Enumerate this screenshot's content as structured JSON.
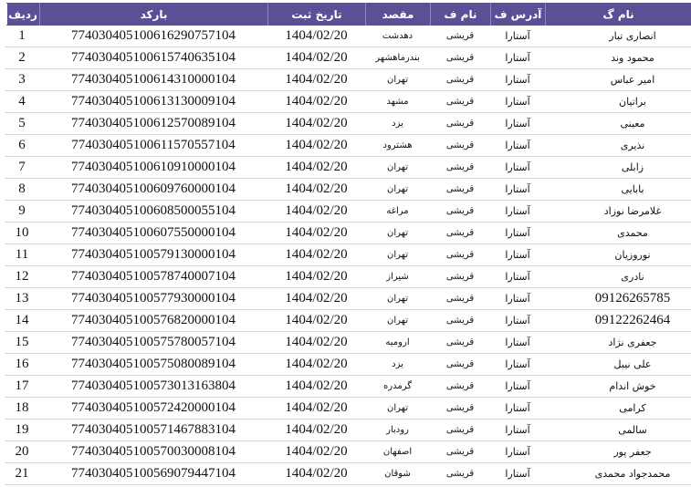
{
  "columns": {
    "idx": "ردیف",
    "barcode": "بارکد",
    "date": "تاریخ ثبت",
    "dest": "مقصد",
    "lname": "نام ف",
    "addr": "آدرس ف",
    "fname": "نام گ"
  },
  "rows": [
    {
      "idx": "1",
      "barcode": "774030405100616290757104",
      "date": "1404/02/20",
      "dest": "دهدشت",
      "lname": "قریشی",
      "addr": "آستارا",
      "fname": "انصاری تبار"
    },
    {
      "idx": "2",
      "barcode": "774030405100615740635104",
      "date": "1404/02/20",
      "dest": "بندرماهشهر",
      "lname": "قریشی",
      "addr": "آستارا",
      "fname": "محمود وند"
    },
    {
      "idx": "3",
      "barcode": "774030405100614310000104",
      "date": "1404/02/20",
      "dest": "تهران",
      "lname": "قریشی",
      "addr": "آستارا",
      "fname": "امیر عباس"
    },
    {
      "idx": "4",
      "barcode": "774030405100613130009104",
      "date": "1404/02/20",
      "dest": "مشهد",
      "lname": "قریشی",
      "addr": "آستارا",
      "fname": "براتیان"
    },
    {
      "idx": "5",
      "barcode": "774030405100612570089104",
      "date": "1404/02/20",
      "dest": "یزد",
      "lname": "قریشی",
      "addr": "آستارا",
      "fname": "معینی"
    },
    {
      "idx": "6",
      "barcode": "774030405100611570557104",
      "date": "1404/02/20",
      "dest": "هشترود",
      "lname": "قریشی",
      "addr": "آستارا",
      "fname": "نذیری"
    },
    {
      "idx": "7",
      "barcode": "774030405100610910000104",
      "date": "1404/02/20",
      "dest": "تهران",
      "lname": "قریشی",
      "addr": "آستارا",
      "fname": "زابلی"
    },
    {
      "idx": "8",
      "barcode": "774030405100609760000104",
      "date": "1404/02/20",
      "dest": "تهران",
      "lname": "قریشی",
      "addr": "آستارا",
      "fname": "بابایی"
    },
    {
      "idx": "9",
      "barcode": "774030405100608500055104",
      "date": "1404/02/20",
      "dest": "مراغه",
      "lname": "قریشی",
      "addr": "آستارا",
      "fname": "غلامرضا نوزاد"
    },
    {
      "idx": "10",
      "barcode": "774030405100607550000104",
      "date": "1404/02/20",
      "dest": "تهران",
      "lname": "قریشی",
      "addr": "آستارا",
      "fname": "محمدی"
    },
    {
      "idx": "11",
      "barcode": "774030405100579130000104",
      "date": "1404/02/20",
      "dest": "تهران",
      "lname": "قریشی",
      "addr": "آستارا",
      "fname": "نوروزیان"
    },
    {
      "idx": "12",
      "barcode": "774030405100578740007104",
      "date": "1404/02/20",
      "dest": "شیراز",
      "lname": "قریشی",
      "addr": "آستارا",
      "fname": "نادری"
    },
    {
      "idx": "13",
      "barcode": "774030405100577930000104",
      "date": "1404/02/20",
      "dest": "تهران",
      "lname": "قریشی",
      "addr": "آستارا",
      "fname": "09126265785",
      "num": true
    },
    {
      "idx": "14",
      "barcode": "774030405100576820000104",
      "date": "1404/02/20",
      "dest": "تهران",
      "lname": "قریشی",
      "addr": "آستارا",
      "fname": "09122262464",
      "num": true
    },
    {
      "idx": "15",
      "barcode": "774030405100575780057104",
      "date": "1404/02/20",
      "dest": "ارومیه",
      "lname": "قریشی",
      "addr": "آستارا",
      "fname": "جعفری نژاد"
    },
    {
      "idx": "16",
      "barcode": "774030405100575080089104",
      "date": "1404/02/20",
      "dest": "یزد",
      "lname": "قریشی",
      "addr": "آستارا",
      "fname": "علی نیبل"
    },
    {
      "idx": "17",
      "barcode": "774030405100573013163804",
      "date": "1404/02/20",
      "dest": "گرمدره",
      "lname": "قریشی",
      "addr": "آستارا",
      "fname": "خوش اندام"
    },
    {
      "idx": "18",
      "barcode": "774030405100572420000104",
      "date": "1404/02/20",
      "dest": "تهران",
      "lname": "قریشی",
      "addr": "آستارا",
      "fname": "کرامی"
    },
    {
      "idx": "19",
      "barcode": "774030405100571467883104",
      "date": "1404/02/20",
      "dest": "رودبار",
      "lname": "قریشی",
      "addr": "آستارا",
      "fname": "سالمی"
    },
    {
      "idx": "20",
      "barcode": "774030405100570030008104",
      "date": "1404/02/20",
      "dest": "اصفهان",
      "lname": "قریشی",
      "addr": "آستارا",
      "fname": "جعفر پور"
    },
    {
      "idx": "21",
      "barcode": "774030405100569079447104",
      "date": "1404/02/20",
      "dest": "شوقان",
      "lname": "قریشی",
      "addr": "آستارا",
      "fname": "محمدجواد محمدی"
    }
  ],
  "colors": {
    "header_bg": "#5b4f96",
    "header_text": "#ffffff",
    "row_line": "#cfd8e6"
  }
}
